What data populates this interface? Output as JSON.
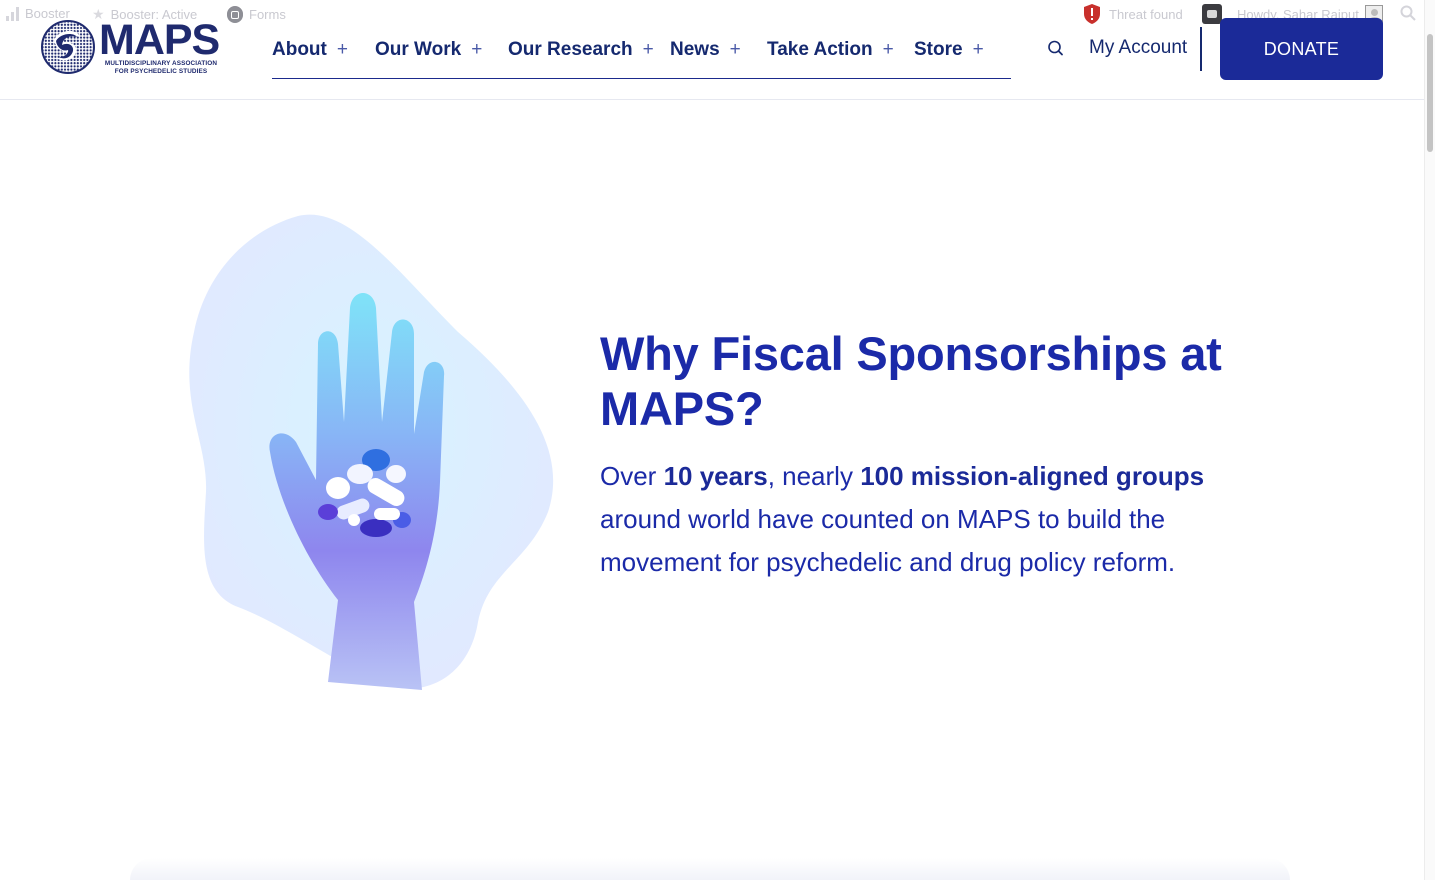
{
  "admin_bar": {
    "booster": "Booster",
    "booster_active": "Booster: Active",
    "forms": "Forms",
    "threat": "Threat found",
    "howdy": "Howdy, Sahar Rajput"
  },
  "header": {
    "logo": {
      "word": "MAPS",
      "sub_line1": "MULTIDISCIPLINARY ASSOCIATION",
      "sub_line2": "FOR PSYCHEDELIC STUDIES"
    },
    "nav": [
      {
        "label": "About"
      },
      {
        "label": "Our Work"
      },
      {
        "label": "Our Research"
      },
      {
        "label": "News"
      },
      {
        "label": "Take Action"
      },
      {
        "label": "Store"
      }
    ],
    "plus_glyph": "+",
    "search_icon": "search-icon",
    "account_label": "My Account",
    "donate_label": "DONATE"
  },
  "hero": {
    "heading": "Why Fiscal Sponsorships at MAPS?",
    "para": {
      "t1": "Over ",
      "b1": "10 years",
      "t2": ", nearly ",
      "b2": "100 mission-aligned groups",
      "t3": " around world have counted on MAPS to build the movement for psychedelic and drug policy reform."
    },
    "image": "hand-holding-pills-illustration"
  },
  "colors": {
    "brand_navy": "#1b2a98",
    "text_blue": "#1b2aa8",
    "blob": "#e4ebff"
  }
}
